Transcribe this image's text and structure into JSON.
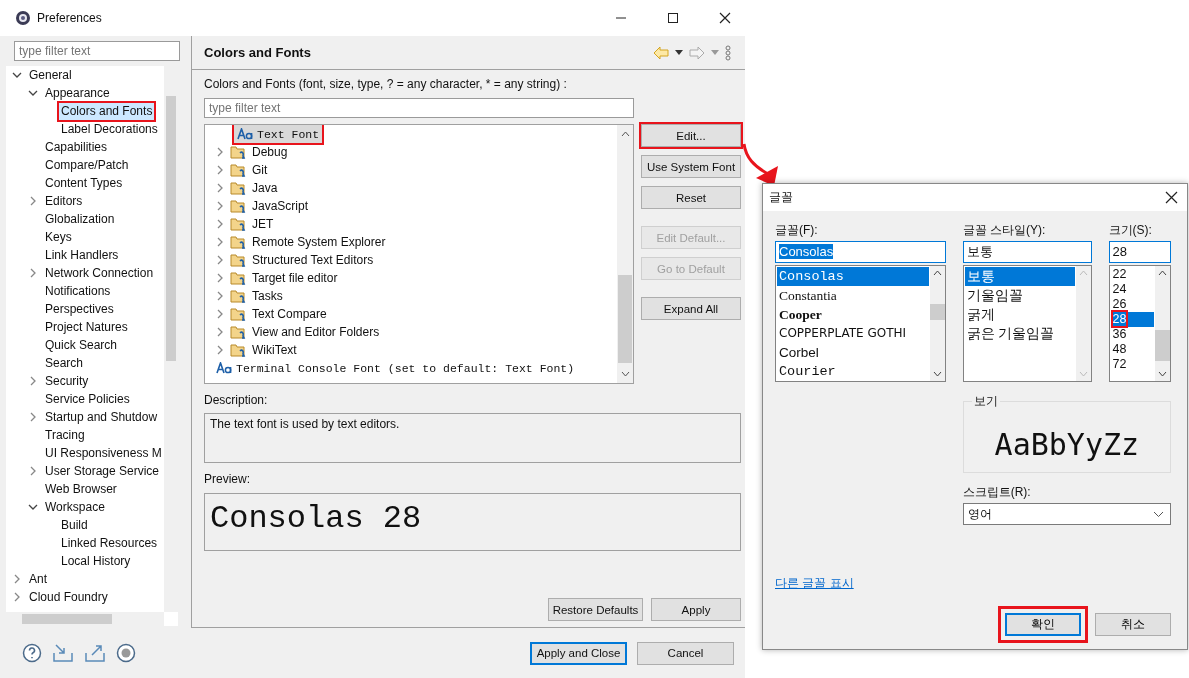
{
  "window": {
    "title": "Preferences"
  },
  "sidebar": {
    "filter_placeholder": "type filter text",
    "tree": [
      {
        "label": "General",
        "expanded": true,
        "selected": false,
        "marked": false,
        "children": [
          {
            "label": "Appearance",
            "expanded": true,
            "selected": false,
            "marked": false,
            "children": [
              {
                "label": "Colors and Fonts",
                "selected": true,
                "marked": true
              },
              {
                "label": "Label Decorations",
                "selected": false,
                "marked": false
              }
            ]
          },
          {
            "label": "Capabilities",
            "selected": false,
            "marked": false
          },
          {
            "label": "Compare/Patch",
            "selected": false,
            "marked": false
          },
          {
            "label": "Content Types",
            "selected": false,
            "marked": false
          },
          {
            "label": "Editors",
            "expanded": false,
            "selected": false,
            "marked": false
          },
          {
            "label": "Globalization",
            "selected": false,
            "marked": false
          },
          {
            "label": "Keys",
            "selected": false,
            "marked": false
          },
          {
            "label": "Link Handlers",
            "selected": false,
            "marked": false
          },
          {
            "label": "Network Connection",
            "expanded": false,
            "selected": false,
            "marked": false
          },
          {
            "label": "Notifications",
            "selected": false,
            "marked": false
          },
          {
            "label": "Perspectives",
            "selected": false,
            "marked": false
          },
          {
            "label": "Project Natures",
            "selected": false,
            "marked": false
          },
          {
            "label": "Quick Search",
            "selected": false,
            "marked": false
          },
          {
            "label": "Search",
            "selected": false,
            "marked": false
          },
          {
            "label": "Security",
            "expanded": false,
            "selected": false,
            "marked": false
          },
          {
            "label": "Service Policies",
            "selected": false,
            "marked": false
          },
          {
            "label": "Startup and Shutdow",
            "expanded": false,
            "selected": false,
            "marked": false
          },
          {
            "label": "Tracing",
            "selected": false,
            "marked": false
          },
          {
            "label": "UI Responsiveness M",
            "selected": false,
            "marked": false
          },
          {
            "label": "User Storage Service",
            "expanded": false,
            "selected": false,
            "marked": false
          },
          {
            "label": "Web Browser",
            "selected": false,
            "marked": false
          },
          {
            "label": "Workspace",
            "expanded": true,
            "selected": false,
            "marked": false,
            "children": [
              {
                "label": "Build",
                "selected": false,
                "marked": false
              },
              {
                "label": "Linked Resources",
                "selected": false,
                "marked": false
              },
              {
                "label": "Local History",
                "selected": false,
                "marked": false
              }
            ]
          }
        ]
      },
      {
        "label": "Ant",
        "expanded": false,
        "selected": false,
        "marked": false
      },
      {
        "label": "Cloud Foundry",
        "expanded": false,
        "selected": false,
        "marked": false
      }
    ]
  },
  "page": {
    "title": "Colors and Fonts",
    "filter_label": "Colors and Fonts (font, size, type, ? = any character, * = any string) :",
    "filter_placeholder": "type filter text",
    "tree": [
      {
        "kind": "hidden-parent",
        "children": [
          {
            "kind": "font",
            "label": "Text Font",
            "selected": true,
            "marked": true
          }
        ]
      },
      {
        "kind": "category",
        "label": "Debug",
        "expanded": false,
        "selected": false,
        "marked": false
      },
      {
        "kind": "category",
        "label": "Git",
        "expanded": false,
        "selected": false,
        "marked": false
      },
      {
        "kind": "category",
        "label": "Java",
        "expanded": false,
        "selected": false,
        "marked": false
      },
      {
        "kind": "category",
        "label": "JavaScript",
        "expanded": false,
        "selected": false,
        "marked": false
      },
      {
        "kind": "category",
        "label": "JET",
        "expanded": false,
        "selected": false,
        "marked": false
      },
      {
        "kind": "category",
        "label": "Remote System Explorer",
        "expanded": false,
        "selected": false,
        "marked": false
      },
      {
        "kind": "category",
        "label": "Structured Text Editors",
        "expanded": false,
        "selected": false,
        "marked": false
      },
      {
        "kind": "category",
        "label": "Target file editor",
        "expanded": false,
        "selected": false,
        "marked": false
      },
      {
        "kind": "category",
        "label": "Tasks",
        "expanded": false,
        "selected": false,
        "marked": false
      },
      {
        "kind": "category",
        "label": "Text Compare",
        "expanded": false,
        "selected": false,
        "marked": false
      },
      {
        "kind": "category",
        "label": "View and Editor Folders",
        "expanded": false,
        "selected": false,
        "marked": false
      },
      {
        "kind": "category",
        "label": "WikiText",
        "expanded": false,
        "selected": false,
        "marked": false
      },
      {
        "kind": "font",
        "label": "Terminal Console Font (set to default: Text Font)",
        "selected": false,
        "marked": false
      }
    ],
    "side_buttons": [
      {
        "label": "Edit...",
        "disabled": false,
        "marked": true
      },
      {
        "label": "Use System Font",
        "disabled": false,
        "marked": false
      },
      {
        "label": "Reset",
        "disabled": false,
        "marked": false
      },
      {
        "label": "Edit Default...",
        "disabled": true,
        "marked": false
      },
      {
        "label": "Go to Default",
        "disabled": true,
        "marked": false
      },
      {
        "label": "Expand All",
        "disabled": false,
        "marked": false
      }
    ],
    "description_label": "Description:",
    "description": "The text font is used by text editors.",
    "preview_label": "Preview:",
    "preview": "Consolas 28",
    "buttons": [
      "Restore Defaults",
      "Apply"
    ]
  },
  "footer_buttons": [
    {
      "label": "Apply and Close",
      "default": true
    },
    {
      "label": "Cancel",
      "default": false
    }
  ],
  "font_dialog": {
    "title": "글꼴",
    "font": {
      "label": "글꼴(F):",
      "value": "Consolas",
      "items": [
        {
          "label": "Consolas",
          "selected": true,
          "marked": false
        },
        {
          "label": "Constantia",
          "selected": false,
          "marked": false
        },
        {
          "label": "Cooper",
          "selected": false,
          "marked": false
        },
        {
          "label": "COPPERPLATE GOTHI",
          "selected": false,
          "marked": false
        },
        {
          "label": "Corbel",
          "selected": false,
          "marked": false
        },
        {
          "label": "Courier",
          "selected": false,
          "marked": false
        }
      ]
    },
    "style": {
      "label": "글꼴 스타일(Y):",
      "value": "보통",
      "items": [
        {
          "label": "보통",
          "selected": true,
          "marked": false
        },
        {
          "label": "기울임꼴",
          "selected": false,
          "marked": false
        },
        {
          "label": "굵게",
          "selected": false,
          "marked": false
        },
        {
          "label": "굵은 기울임꼴",
          "selected": false,
          "marked": false
        }
      ]
    },
    "size": {
      "label": "크기(S):",
      "value": "28",
      "items": [
        {
          "label": "22",
          "selected": false,
          "marked": false
        },
        {
          "label": "24",
          "selected": false,
          "marked": false
        },
        {
          "label": "26",
          "selected": false,
          "marked": false
        },
        {
          "label": "28",
          "selected": true,
          "marked": true
        },
        {
          "label": "36",
          "selected": false,
          "marked": false
        },
        {
          "label": "48",
          "selected": false,
          "marked": false
        },
        {
          "label": "72",
          "selected": false,
          "marked": false
        }
      ]
    },
    "sample_label": "보기",
    "sample": "AaBbYyZz",
    "script_label": "스크립트(R):",
    "script_value": "영어",
    "more_fonts_link": "다른 글꼴 표시",
    "buttons": [
      {
        "label": "확인",
        "default": true,
        "marked": true
      },
      {
        "label": "취소",
        "default": false,
        "marked": false
      }
    ]
  }
}
